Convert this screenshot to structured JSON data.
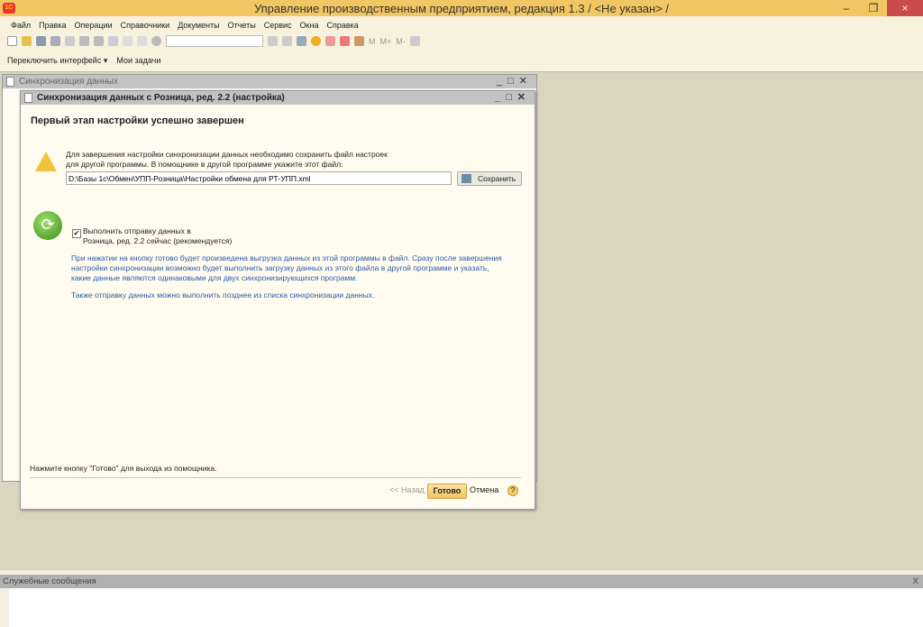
{
  "app": {
    "title": "Управление производственным предприятием, редакция 1.3 / <Не указан> /",
    "logo": "1С"
  },
  "window_controls": {
    "minimize": "–",
    "restore": "❐",
    "close": "×"
  },
  "menu": [
    "Файл",
    "Правка",
    "Операции",
    "Справочники",
    "Документы",
    "Отчеты",
    "Сервис",
    "Окна",
    "Справка"
  ],
  "toolbar": {
    "search_value": "",
    "memory": [
      "M",
      "M+",
      "M-"
    ]
  },
  "toolbar2": {
    "switch_interface": "Переключить интерфейс ▾",
    "my_tasks": "Мои задачи"
  },
  "outer_window": {
    "title": "Синхронизация данных"
  },
  "dialog": {
    "title": "Синхронизация данных с Розница, ред. 2.2 (настройка)",
    "heading": "Первый этап настройки успешно завершен",
    "info_line1": "Для завершения настройки синхронизации данных необходимо сохранить файл настроек",
    "info_line2": "для другой программы. В помощнике в другой программе укажите этот файл:",
    "file_path": "D:\\Базы 1с\\Обмен\\УПП-Розница\\Настройки обмена для РТ-УПП.xml",
    "save_button": "Сохранить",
    "checkbox_line1": "Выполнить отправку данных в",
    "checkbox_line2": "Розница, ред. 2.2 сейчас (рекомендуется)",
    "checkbox_checked": true,
    "note1_line1": "При нажатии на кнопку готово будет произведена выгрузка данных из этой программы в файл. Сразу после завершения",
    "note1_line2": "настройки синхронизации возможно будет выполнить загрузку данных из этого файла в другой программе и указать,",
    "note1_line3": "какие данные являются одинаковыми для двух синхронизирующихся программ.",
    "note2": "Также отправку данных можно выполнить позднее из списка синхронизации данных.",
    "footer_hint": "Нажмите кнопку \"Готово\" для выхода из помощника.",
    "back_button": "<< Назад",
    "done_button": "Готово",
    "cancel_button": "Отмена",
    "help_button": "?"
  },
  "messages_panel": {
    "title": "Служебные сообщения",
    "close": "X"
  },
  "colors": {
    "title_bar": "#f1c663",
    "accent_button": "#f1c562",
    "info_text": "#2a5aa8"
  }
}
